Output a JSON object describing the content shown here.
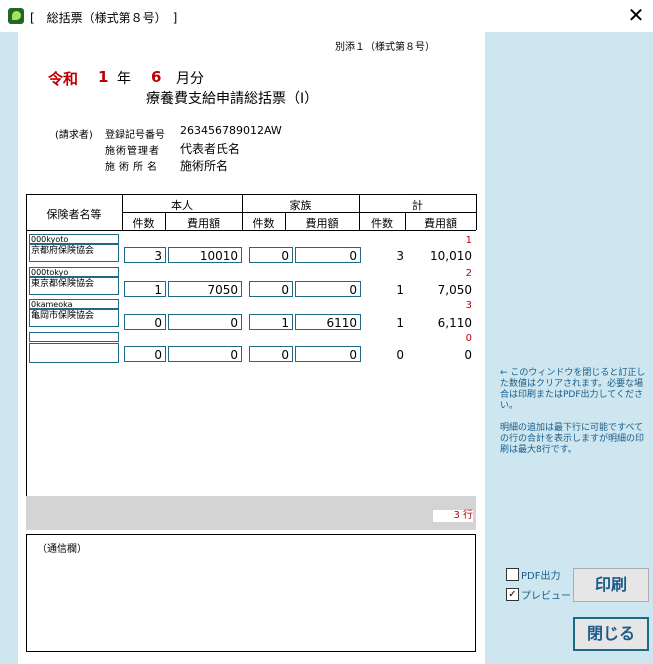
{
  "window": {
    "title": "[　総括票（様式第８号）　]",
    "close_glyph": "✕"
  },
  "header": {
    "annex": "別添１（様式第８号）",
    "era": "令和",
    "year": "1",
    "year_label": "年",
    "month": "6",
    "month_label": "月分",
    "form_title": "療養費支給申請総括票（Ⅰ）"
  },
  "claimant": {
    "label": "(請求者)",
    "reg_no_label": "登録記号番号",
    "reg_no": "263456789012AW",
    "manager_label": "施術管理者",
    "manager": "代表者氏名",
    "clinic_label": "施術所名",
    "clinic": "施術所名"
  },
  "table": {
    "insurer_header": "保険者名等",
    "group_self": "本人",
    "group_family": "家族",
    "group_total": "計",
    "col_count": "件数",
    "col_amount": "費用額",
    "rows": [
      {
        "rownum": "1",
        "code": "000kyoto",
        "name": "京都府保険協会",
        "self_count": "3",
        "self_amount": "10010",
        "fam_count": "0",
        "fam_amount": "0",
        "total_count": "3",
        "total_amount": "10,010"
      },
      {
        "rownum": "2",
        "code": "000tokyo",
        "name": "東京都保険協会",
        "self_count": "1",
        "self_amount": "7050",
        "fam_count": "0",
        "fam_amount": "0",
        "total_count": "1",
        "total_amount": "7,050"
      },
      {
        "rownum": "3",
        "code": "0kameoka",
        "name": "亀岡市保険協会",
        "self_count": "0",
        "self_amount": "0",
        "fam_count": "1",
        "fam_amount": "6110",
        "total_count": "1",
        "total_amount": "6,110"
      },
      {
        "rownum": "0",
        "code": "",
        "name": "",
        "self_count": "0",
        "self_amount": "0",
        "fam_count": "0",
        "fam_amount": "0",
        "total_count": "0",
        "total_amount": "0"
      }
    ],
    "row_count": "3 行"
  },
  "remarks": {
    "label": "（通信欄）"
  },
  "side_note": "← このウィンドウを閉じると訂正した数値はクリアされます。必要な場合は印刷またはPDF出力してください。\n\n明細の追加は最下行に可能ですべての行の合計を表示しますが明細の印刷は最大8行です。",
  "controls": {
    "pdf_label": "PDF出力",
    "pdf_checked": false,
    "preview_label": "プレビュー",
    "preview_checked": true,
    "print_label": "印刷",
    "close_label": "閉じる"
  },
  "colors": {
    "accent_red": "#c00000",
    "panel_bg": "#cde6ef",
    "field_border": "#1c6a86"
  }
}
